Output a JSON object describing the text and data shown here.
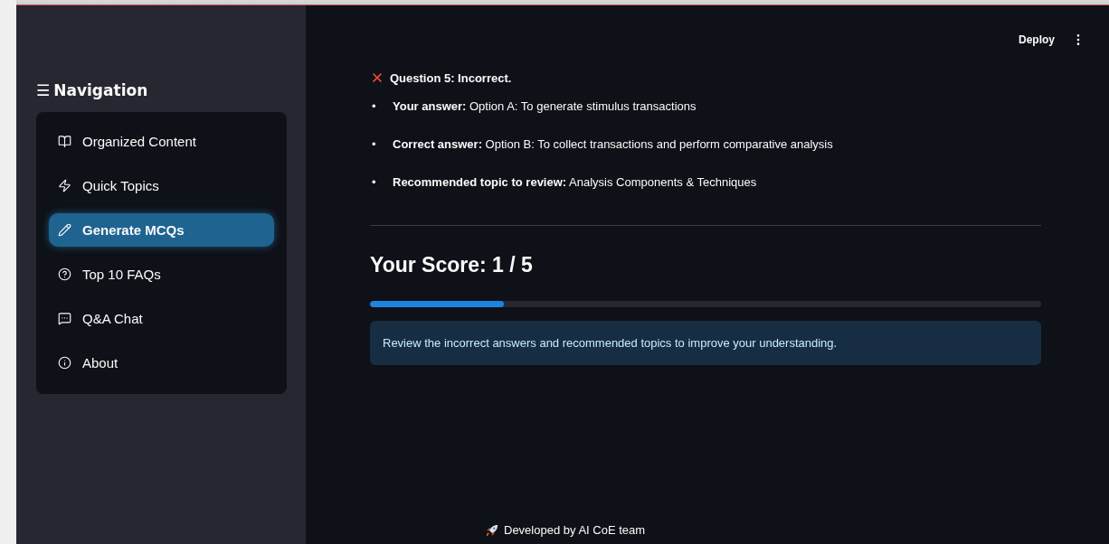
{
  "sidebar": {
    "menu_glyph": "☰",
    "title": "Navigation",
    "items": [
      {
        "label": "Organized Content",
        "kind": "book",
        "selected": false
      },
      {
        "label": "Quick Topics",
        "kind": "bolt",
        "selected": false
      },
      {
        "label": "Generate MCQs",
        "kind": "pencil",
        "selected": true
      },
      {
        "label": "Top 10 FAQs",
        "kind": "help",
        "selected": false
      },
      {
        "label": "Q&A Chat",
        "kind": "chat",
        "selected": false
      },
      {
        "label": "About",
        "kind": "info",
        "selected": false
      }
    ]
  },
  "header": {
    "deploy": "Deploy"
  },
  "result": {
    "correct": false,
    "title": "Question 5: Incorrect.",
    "bullets": [
      {
        "marker": "•",
        "text": "**Your answer:** Option A: To generate stimulus transactions"
      },
      {
        "marker": "•",
        "text": "**Correct answer:** Option B: To collect transactions and perform comparative analysis"
      },
      {
        "marker": "•",
        "text": "**Recommended topic to review:** Analysis Components & Techniques"
      }
    ]
  },
  "score": {
    "title": "Your Score: 1 / 5",
    "level": 0.2,
    "message": "Review the incorrect answers and recommended topics to improve your understanding."
  },
  "footer": {
    "text": "Developed by AI CoE team"
  }
}
